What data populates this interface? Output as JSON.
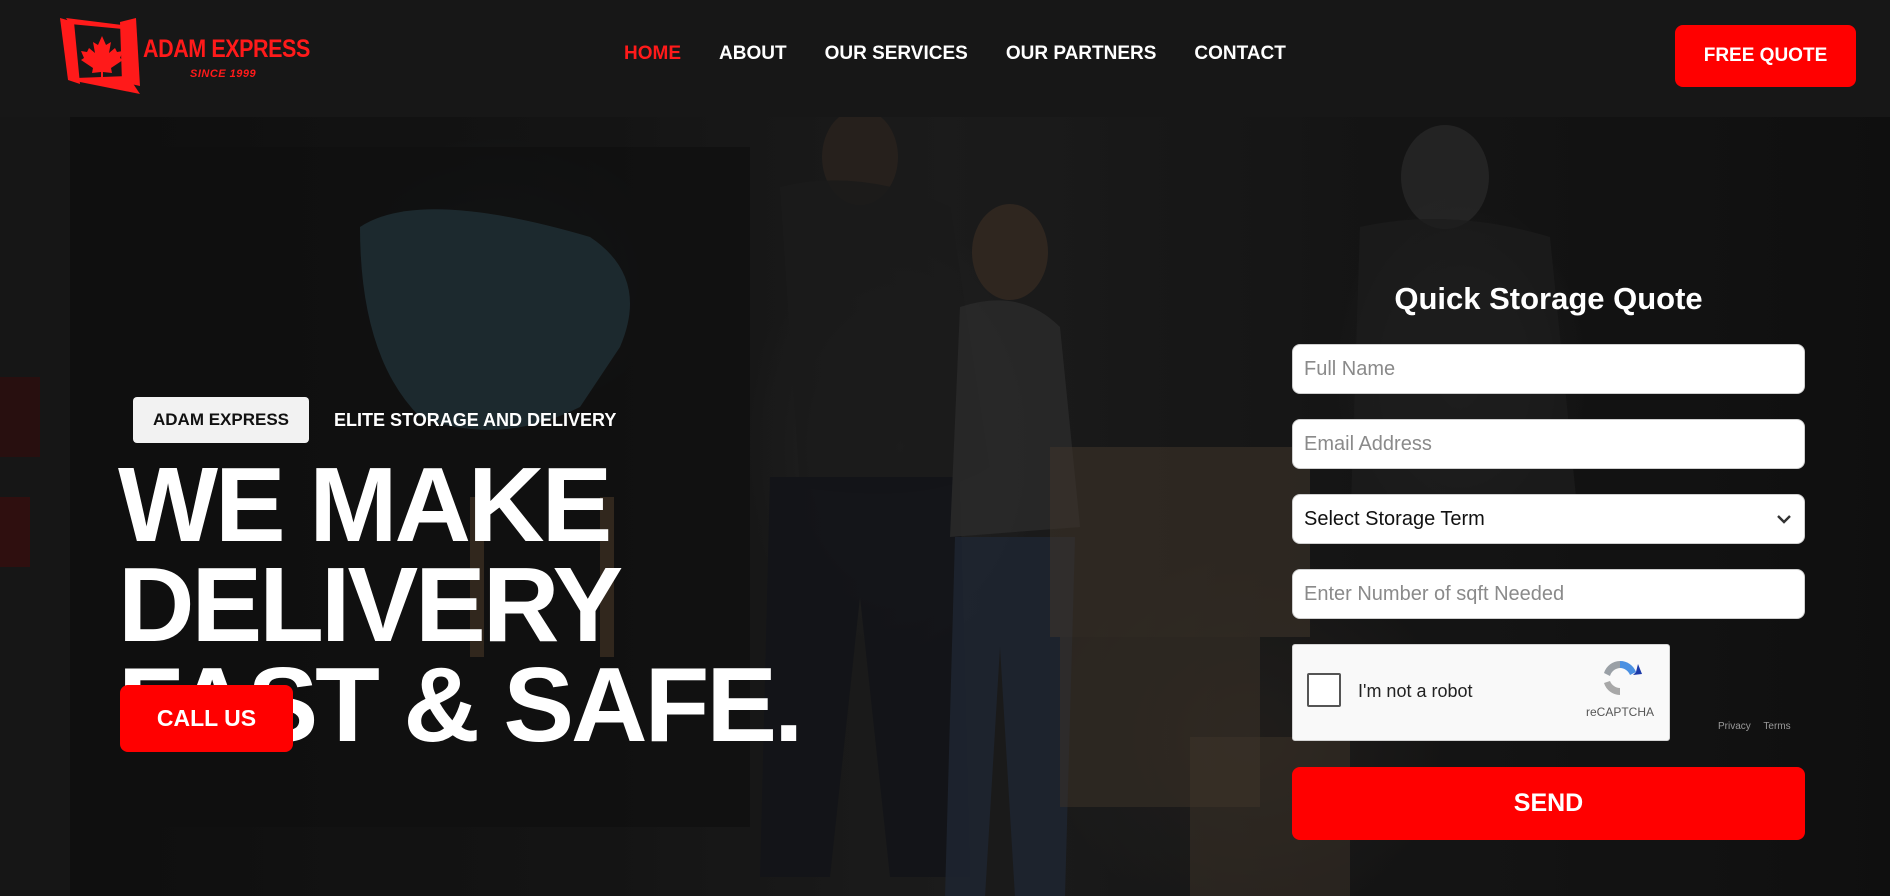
{
  "brand": {
    "name": "ADAM EXPRESS",
    "since": "SINCE 1999",
    "color": "#ff1a1a",
    "logo_icon": "maple-leaf-flag-icon"
  },
  "nav": {
    "items": [
      {
        "label": "HOME",
        "active": true
      },
      {
        "label": "ABOUT",
        "active": false
      },
      {
        "label": "OUR SERVICES",
        "active": false
      },
      {
        "label": "OUR PARTNERS",
        "active": false
      },
      {
        "label": "CONTACT",
        "active": false
      }
    ],
    "cta": "FREE QUOTE"
  },
  "hero": {
    "badge": "ADAM EXPRESS",
    "tagline": "ELITE STORAGE AND DELIVERY",
    "headline_line1": "WE MAKE DELIVERY",
    "headline_line2": "FAST & SAFE.",
    "call_button": "CALL US"
  },
  "form": {
    "title": "Quick Storage Quote",
    "full_name_placeholder": "Full Name",
    "email_placeholder": "Email Address",
    "storage_term_selected": "Select Storage Term",
    "sqft_placeholder": "Enter Number of sqft Needed",
    "recaptcha_label": "I'm not a robot",
    "recaptcha_brand": "reCAPTCHA",
    "recaptcha_privacy": "Privacy",
    "recaptcha_terms": "Terms",
    "send_button": "SEND"
  },
  "colors": {
    "accent": "#ff0000",
    "header_bg": "#171717"
  }
}
